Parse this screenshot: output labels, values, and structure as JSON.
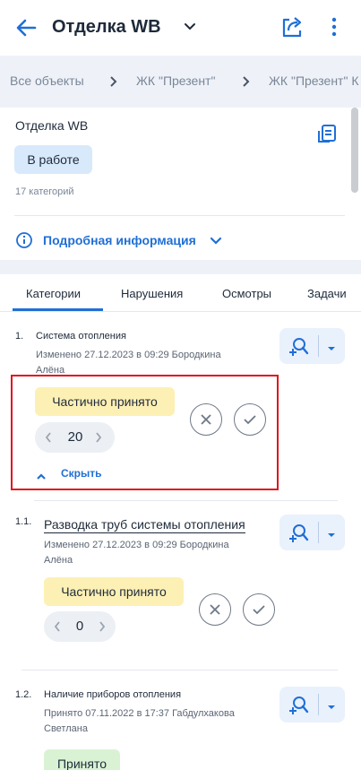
{
  "header": {
    "title": "Отделка WB",
    "icons": {
      "back": "arrow-left-icon",
      "dropdown": "chevron-down-icon",
      "share": "share-icon",
      "more": "more-vertical-icon"
    }
  },
  "breadcrumbs": [
    "Все объекты",
    "ЖК \"Презент\"",
    "ЖК \"Презент\" К"
  ],
  "object": {
    "name": "Отделка WB",
    "status": "В работе",
    "category_count": "17 категорий",
    "details_link": "Подробная информация"
  },
  "tabs": [
    "Категории",
    "Нарушения",
    "Осмотры",
    "Задачи"
  ],
  "active_tab": "Категории",
  "items": [
    {
      "number": "1.",
      "title": "Система отопления",
      "meta_line1": "Изменено 27.12.2023 в 09:29 Бородкина",
      "meta_line2": "Алёна",
      "status": "Частично принято",
      "count": "20",
      "collapse": "Скрыть"
    },
    {
      "number": "1.1.",
      "title": "Разводка труб системы отопления",
      "meta_line1": "Изменено 27.12.2023 в 09:29 Бородкина",
      "meta_line2": "Алёна",
      "status": "Частично принято",
      "count": "0"
    },
    {
      "number": "1.2.",
      "title": "Наличие приборов отопления",
      "meta_line1": "Принято 07.11.2022 в 17:37 Габдулхакова",
      "meta_line2": "Светлана",
      "status": "Принято"
    }
  ],
  "colors": {
    "accent": "#1f6fd6",
    "partial": "#fdf0b5",
    "accepted": "#d9f2d4",
    "in_work": "#d8e9fb",
    "highlight": "#e0141e"
  }
}
